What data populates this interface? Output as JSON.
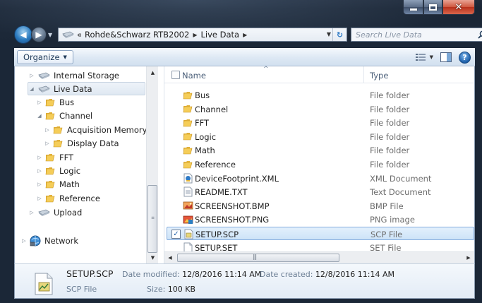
{
  "window": {
    "colors": {
      "accent": "#84acdd",
      "frame": "#1c2838",
      "close": "#c9462e"
    }
  },
  "address": {
    "prefix": "«",
    "crumbs": [
      "Rohde&Schwarz RTB2002",
      "Live Data"
    ],
    "search_placeholder": "Search Live Data"
  },
  "toolbar": {
    "organize_label": "Organize",
    "icons": [
      "views-icon",
      "preview-pane-icon",
      "help-icon"
    ]
  },
  "nav_tree": [
    {
      "label": "Internal Storage",
      "icon": "drive-icon",
      "level": 1,
      "expand": "closed"
    },
    {
      "label": "Live Data",
      "icon": "drive-icon",
      "level": 1,
      "expand": "open",
      "selected": true
    },
    {
      "label": "Bus",
      "icon": "folder-icon",
      "level": 2,
      "expand": "closed"
    },
    {
      "label": "Channel",
      "icon": "folder-icon",
      "level": 2,
      "expand": "open"
    },
    {
      "label": "Acquisition Memory",
      "icon": "folder-icon",
      "level": 3,
      "expand": "closed"
    },
    {
      "label": "Display Data",
      "icon": "folder-icon",
      "level": 3,
      "expand": "closed"
    },
    {
      "label": "FFT",
      "icon": "folder-icon",
      "level": 2,
      "expand": "closed"
    },
    {
      "label": "Logic",
      "icon": "folder-icon",
      "level": 2,
      "expand": "closed"
    },
    {
      "label": "Math",
      "icon": "folder-icon",
      "level": 2,
      "expand": "closed"
    },
    {
      "label": "Reference",
      "icon": "folder-icon",
      "level": 2,
      "expand": "closed"
    },
    {
      "label": "Upload",
      "icon": "drive-icon",
      "level": 1,
      "expand": "closed"
    },
    {
      "label": "Network",
      "icon": "network-icon",
      "level": 0,
      "expand": "closed"
    }
  ],
  "file_list": {
    "columns": [
      "Name",
      "Type"
    ],
    "rows": [
      {
        "name": "Bus",
        "type": "File folder",
        "icon": "folder-icon"
      },
      {
        "name": "Channel",
        "type": "File folder",
        "icon": "folder-icon"
      },
      {
        "name": "FFT",
        "type": "File folder",
        "icon": "folder-icon"
      },
      {
        "name": "Logic",
        "type": "File folder",
        "icon": "folder-icon"
      },
      {
        "name": "Math",
        "type": "File folder",
        "icon": "folder-icon"
      },
      {
        "name": "Reference",
        "type": "File folder",
        "icon": "folder-icon"
      },
      {
        "name": "DeviceFootprint.XML",
        "type": "XML Document",
        "icon": "xml-file-icon"
      },
      {
        "name": "README.TXT",
        "type": "Text Document",
        "icon": "text-file-icon"
      },
      {
        "name": "SCREENSHOT.BMP",
        "type": "BMP File",
        "icon": "bmp-file-icon"
      },
      {
        "name": "SCREENSHOT.PNG",
        "type": "PNG image",
        "icon": "png-file-icon"
      },
      {
        "name": "SETUP.SCP",
        "type": "SCP File",
        "icon": "scp-file-icon",
        "selected": true,
        "checked": true
      },
      {
        "name": "SETUP.SET",
        "type": "SET File",
        "icon": "blank-file-icon"
      }
    ]
  },
  "details": {
    "name": "SETUP.SCP",
    "type": "SCP File",
    "modified_label": "Date modified:",
    "modified_value": "12/8/2016 11:14 AM",
    "created_label": "Date created:",
    "created_value": "12/8/2016 11:14 AM",
    "size_label": "Size:",
    "size_value": "100 KB"
  }
}
